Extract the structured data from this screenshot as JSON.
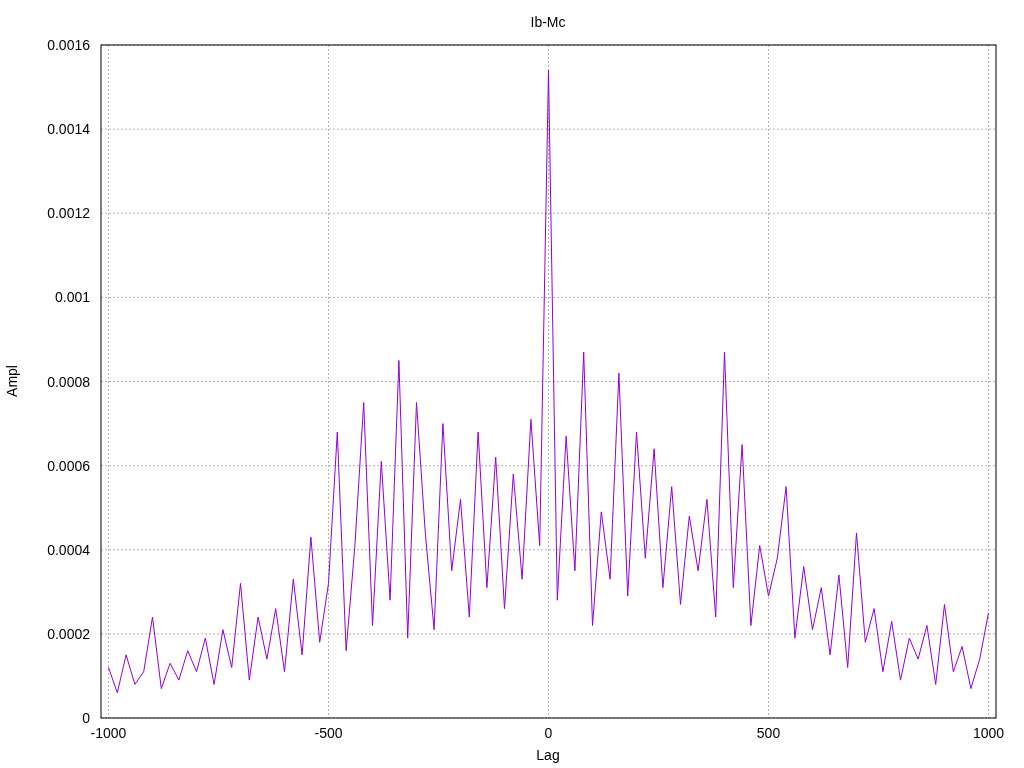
{
  "chart_data": {
    "type": "line",
    "title": "Ib-Mc",
    "xlabel": "Lag",
    "ylabel": "Ampl",
    "grid": true,
    "xlim": [
      -1017,
      1017
    ],
    "ylim": [
      0,
      0.0016
    ],
    "xticks": [
      -1000,
      -500,
      0,
      500,
      1000
    ],
    "yticks": [
      {
        "value": 0,
        "label": "0"
      },
      {
        "value": 0.0002,
        "label": "0.0002"
      },
      {
        "value": 0.0004,
        "label": "0.0004"
      },
      {
        "value": 0.0006,
        "label": "0.0006"
      },
      {
        "value": 0.0008,
        "label": "0.0008"
      },
      {
        "value": 0.001,
        "label": "0.001"
      },
      {
        "value": 0.0012,
        "label": "0.0012"
      },
      {
        "value": 0.0014,
        "label": "0.0014"
      },
      {
        "value": 0.0016,
        "label": "0.0016"
      }
    ],
    "x": [
      -1000,
      -980,
      -960,
      -940,
      -920,
      -900,
      -880,
      -860,
      -840,
      -820,
      -800,
      -780,
      -760,
      -740,
      -720,
      -700,
      -680,
      -660,
      -640,
      -620,
      -600,
      -580,
      -560,
      -540,
      -520,
      -500,
      -480,
      -460,
      -440,
      -420,
      -400,
      -380,
      -360,
      -340,
      -320,
      -300,
      -280,
      -260,
      -240,
      -220,
      -200,
      -180,
      -160,
      -140,
      -120,
      -100,
      -80,
      -60,
      -40,
      -20,
      0,
      20,
      40,
      60,
      80,
      100,
      120,
      140,
      160,
      180,
      200,
      220,
      240,
      260,
      280,
      300,
      320,
      340,
      360,
      380,
      400,
      420,
      440,
      460,
      480,
      500,
      520,
      540,
      560,
      580,
      600,
      620,
      640,
      660,
      680,
      700,
      720,
      740,
      760,
      780,
      800,
      820,
      840,
      860,
      880,
      900,
      920,
      940,
      960,
      980,
      1000
    ],
    "series": [
      {
        "color": "#9400d3",
        "values": [
          0.00012,
          6e-05,
          0.00015,
          8e-05,
          0.00011,
          0.00024,
          7e-05,
          0.00013,
          9e-05,
          0.00016,
          0.00011,
          0.00019,
          8e-05,
          0.00021,
          0.00012,
          0.00032,
          9e-05,
          0.00024,
          0.00014,
          0.00026,
          0.00011,
          0.00033,
          0.00015,
          0.00043,
          0.00018,
          0.00032,
          0.00068,
          0.00016,
          0.00041,
          0.00075,
          0.00022,
          0.00061,
          0.00028,
          0.00085,
          0.00019,
          0.00075,
          0.00044,
          0.00021,
          0.0007,
          0.00035,
          0.00052,
          0.00024,
          0.00068,
          0.00031,
          0.00062,
          0.00026,
          0.00058,
          0.00033,
          0.00071,
          0.00041,
          0.00154,
          0.00028,
          0.00067,
          0.00035,
          0.00087,
          0.00022,
          0.00049,
          0.00033,
          0.00082,
          0.00029,
          0.00068,
          0.00038,
          0.00064,
          0.00031,
          0.00055,
          0.00027,
          0.00048,
          0.00035,
          0.00052,
          0.00024,
          0.00087,
          0.00031,
          0.00065,
          0.00022,
          0.00041,
          0.00029,
          0.00038,
          0.00055,
          0.00019,
          0.00036,
          0.00021,
          0.00031,
          0.00015,
          0.00034,
          0.00012,
          0.00044,
          0.00018,
          0.00026,
          0.00011,
          0.00023,
          9e-05,
          0.00019,
          0.00014,
          0.00022,
          8e-05,
          0.00027,
          0.00011,
          0.00017,
          7e-05,
          0.00014,
          0.00025
        ]
      }
    ]
  }
}
